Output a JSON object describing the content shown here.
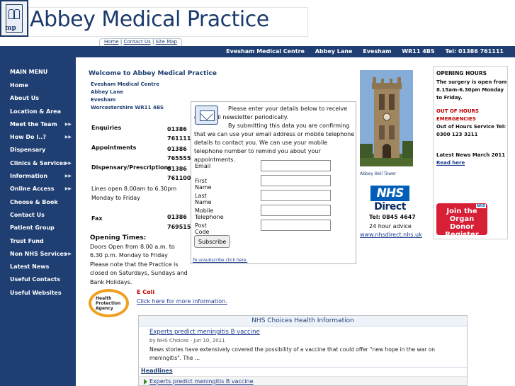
{
  "header": {
    "logo_letters": "mp",
    "site_title": "Abbey Medical Practice",
    "toplinks": [
      "Home",
      "Contact Us",
      "Site Map"
    ],
    "infobar": [
      "Evesham Medical Centre",
      "Abbey Lane",
      "Evesham",
      "WR11 4BS",
      "Tel: 01386 761111"
    ]
  },
  "sidebar": {
    "title": "MAIN MENU",
    "items": [
      {
        "label": "Home",
        "arrow": ""
      },
      {
        "label": "About Us",
        "arrow": ""
      },
      {
        "label": "Location & Area",
        "arrow": ""
      },
      {
        "label": "Meet the Team",
        "arrow": "▶▶"
      },
      {
        "label": "How Do I..?",
        "arrow": "▶▶"
      },
      {
        "label": "Dispensary",
        "arrow": ""
      },
      {
        "label": "Clinics & Services",
        "arrow": "▶▶"
      },
      {
        "label": "Information",
        "arrow": "▶▶"
      },
      {
        "label": "Online Access",
        "arrow": "▶▶"
      },
      {
        "label": "Choose & Book",
        "arrow": ""
      },
      {
        "label": "Contact Us",
        "arrow": ""
      },
      {
        "label": "Patient Group",
        "arrow": ""
      },
      {
        "label": "Trust Fund",
        "arrow": ""
      },
      {
        "label": "Non NHS Services",
        "arrow": "▶▶"
      },
      {
        "label": "Latest News",
        "arrow": ""
      },
      {
        "label": "Useful Contacts",
        "arrow": ""
      },
      {
        "label": "Useful Websites",
        "arrow": ""
      }
    ]
  },
  "main": {
    "welcome": "Welcome to Abbey Medical Practice",
    "address": [
      "Evesham Medical Centre",
      "Abbey Lane",
      "Evesham",
      "Worcestershire"
    ],
    "postcode": "WR11 4BS",
    "contacts": [
      {
        "label": "Enquiries",
        "value": "01386 761111"
      },
      {
        "label": "Appointments",
        "value": "01386 765555"
      },
      {
        "label": "Dispensary/Prescriptions",
        "value": "01386 761100"
      }
    ],
    "lines_open": "Lines open 8.00am to 6.30pm Monday to Friday",
    "fax_label": "Fax",
    "fax_value": "01386 769515",
    "opening_title": "Opening Times:",
    "opening_text": "Doors Open from 8.00 a.m. to 6.30 p.m. Monday to Friday",
    "closed_text": "Please note that the Practice is closed on Saturdays, Sundays and Bank Holidays."
  },
  "newsletter": {
    "intro": "Please enter your details below to receive our email newsletter periodically.",
    "consent": "By submitting this data you are confirming that we can use your email address or mobile telephone details to contact you. We can use your mobile telephone number to remind you about your appointments.",
    "fields": [
      {
        "label": "Email",
        "value": ""
      },
      {
        "label": "First Name",
        "value": ""
      },
      {
        "label": "Last Name",
        "value": ""
      },
      {
        "label": "Mobile Telephone",
        "value": ""
      },
      {
        "label": "Post Code",
        "value": ""
      }
    ],
    "submit_label": "Subscribe",
    "unsubscribe": "To unsubscribe click here."
  },
  "photo": {
    "caption": "Abbey Bell Tower"
  },
  "nhs_direct": {
    "logo": "NHS",
    "logo_sub": "Direct",
    "tel": "Tel: 0845 4647",
    "advice": "24 hour advice",
    "link": "www.nhsdirect.nhs.uk"
  },
  "hours_box": {
    "title": "OPENING HOURS",
    "body": "The surgery is open from 8.15am-6.30pm Monday to Friday.",
    "ooh_title": "OUT OF HOURS EMERGENCIES",
    "ooh_body": "Out of Hours Service Tel:",
    "ooh_tel": "0300 123 3211",
    "news": "Latest News March 2011",
    "read_more": "Read here"
  },
  "organ": {
    "text": "Join the Organ Donor Register",
    "badge": "NHS"
  },
  "ecoli": {
    "logo_text": "Health Protection Agency",
    "title": "E Coli",
    "link": "Click here for more information."
  },
  "choices": {
    "title": "NHS Choices Health Information",
    "entry_title": "Experts predict meningitis B vaccine",
    "entry_meta": "by NHS Choices - Jun 10, 2011",
    "entry_desc": "News stories have extensively covered the possibility of a vaccine that could offer \"new hope in the war on meningitis\". The ...",
    "headlines_label": "Headlines",
    "headline": "Experts predict meningitis B vaccine"
  },
  "colors": {
    "navy": "#1f3f72",
    "link": "#1b3a8f",
    "alert_red": "#c00000",
    "nhs_blue": "#005eb8",
    "organ_red": "#d71f36"
  }
}
